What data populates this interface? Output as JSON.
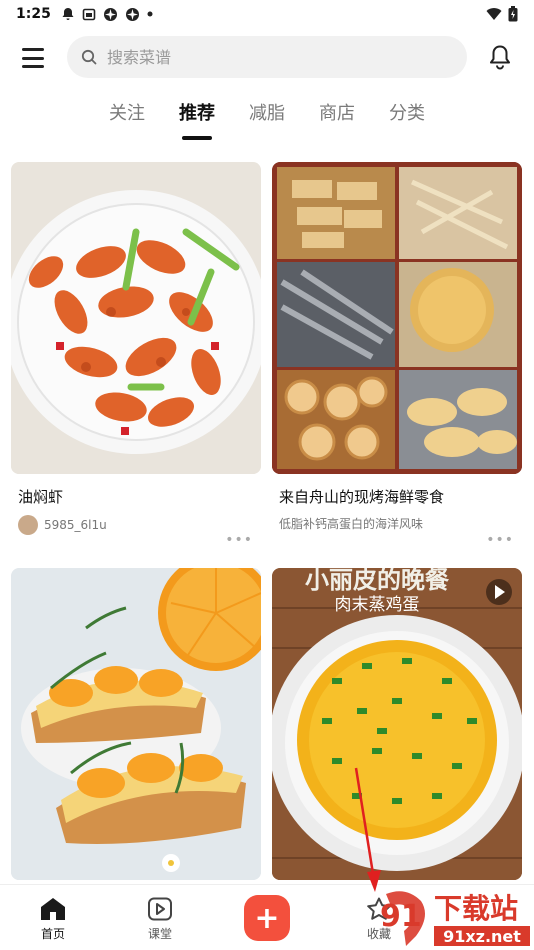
{
  "status_bar": {
    "time": "1:25",
    "left_icons": [
      "notification-icon",
      "calendar-icon",
      "app-icon",
      "app-icon",
      "dot-icon"
    ],
    "right_icons": [
      "wifi-icon",
      "battery-icon"
    ]
  },
  "top_bar": {
    "search_placeholder": "搜索菜谱"
  },
  "tabs": [
    {
      "label": "关注",
      "active": false
    },
    {
      "label": "推荐",
      "active": true
    },
    {
      "label": "减脂",
      "active": false
    },
    {
      "label": "商店",
      "active": false
    },
    {
      "label": "分类",
      "active": false
    }
  ],
  "feed": [
    {
      "title": "油焖虾",
      "author": "5985_6l1u",
      "subtitle": ""
    },
    {
      "title": "来自舟山的现烤海鲜零食",
      "author": "",
      "subtitle": "低脂补钙高蛋白的海洋风味"
    },
    {
      "title": "",
      "author": "",
      "subtitle": ""
    },
    {
      "title": "",
      "author": "",
      "subtitle": "",
      "overlay_title": "小丽皮的晚餐",
      "overlay_subtitle": "肉末蒸鸡蛋"
    }
  ],
  "bottom_nav": [
    {
      "label": "首页",
      "icon": "home-icon",
      "active": true
    },
    {
      "label": "课堂",
      "icon": "play-icon",
      "active": false
    },
    {
      "label": "收藏",
      "icon": "star-icon",
      "active": false
    }
  ],
  "add_button_label": "+",
  "watermark": {
    "logo": "91",
    "brand": "下载站",
    "site": "91xz.net"
  },
  "colors": {
    "accent": "#f3503d",
    "search_bg": "#f1f1f1"
  }
}
